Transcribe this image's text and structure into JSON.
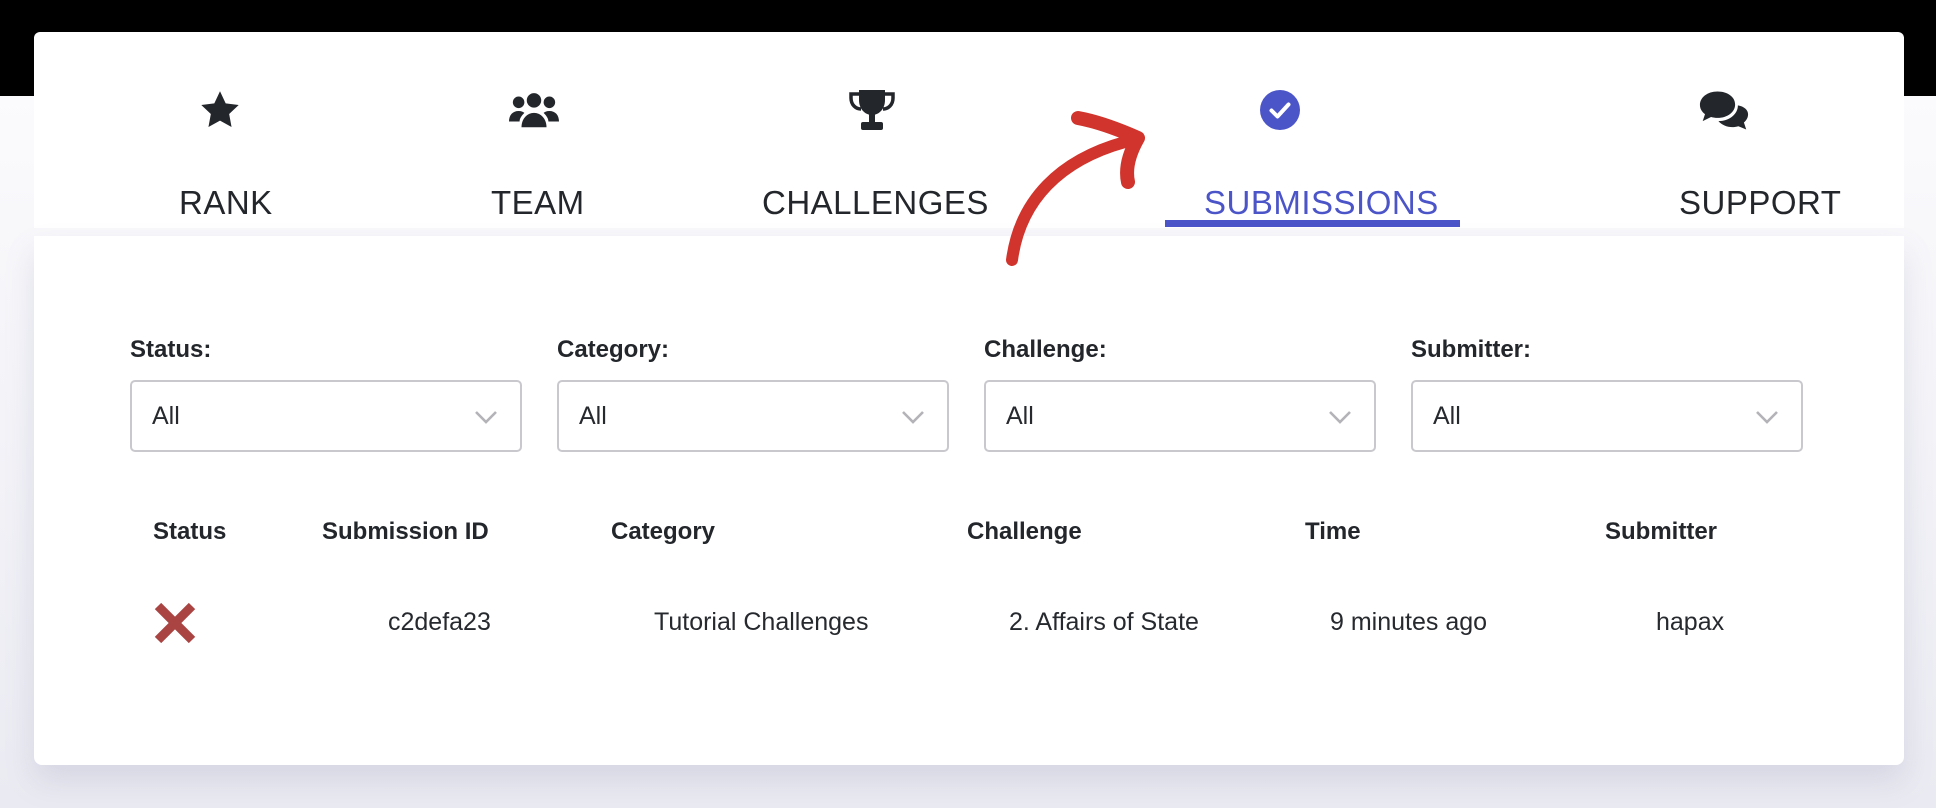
{
  "nav": {
    "items": [
      {
        "label": "RANK",
        "icon": "star-icon"
      },
      {
        "label": "TEAM",
        "icon": "users-icon"
      },
      {
        "label": "CHALLENGES",
        "icon": "trophy-icon"
      },
      {
        "label": "SUBMISSIONS",
        "icon": "check-circle-icon",
        "active": true
      },
      {
        "label": "SUPPORT",
        "icon": "comments-icon"
      }
    ]
  },
  "filters": [
    {
      "label": "Status:",
      "value": "All"
    },
    {
      "label": "Category:",
      "value": "All"
    },
    {
      "label": "Challenge:",
      "value": "All"
    },
    {
      "label": "Submitter:",
      "value": "All"
    }
  ],
  "table": {
    "headers": [
      "Status",
      "Submission ID",
      "Category",
      "Challenge",
      "Time",
      "Submitter"
    ],
    "rows": [
      {
        "status": "incorrect",
        "id": "c2defa23",
        "category": "Tutorial Challenges",
        "challenge": "2. Affairs of State",
        "time": "9 minutes ago",
        "submitter": "hapax"
      }
    ]
  },
  "colors": {
    "accent": "#4c55c8",
    "fail": "#a94442",
    "annotation_arrow": "#d0342c"
  }
}
